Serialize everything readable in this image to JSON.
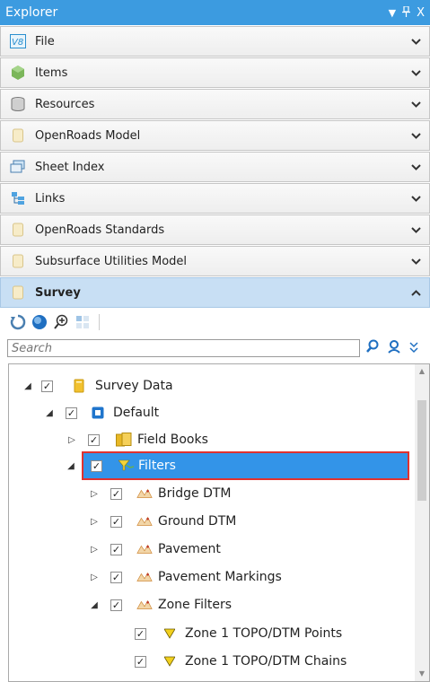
{
  "window": {
    "title": "Explorer",
    "controls": {
      "dropdown": "▼",
      "pin": "📌",
      "close": "X"
    }
  },
  "panels": [
    {
      "label": "File",
      "icon": "v8-file-icon"
    },
    {
      "label": "Items",
      "icon": "items-icon"
    },
    {
      "label": "Resources",
      "icon": "resources-icon"
    },
    {
      "label": "OpenRoads Model",
      "icon": "openroads-model-icon"
    },
    {
      "label": "Sheet Index",
      "icon": "sheet-index-icon"
    },
    {
      "label": "Links",
      "icon": "links-icon"
    },
    {
      "label": "OpenRoads Standards",
      "icon": "openroads-standards-icon"
    },
    {
      "label": "Subsurface Utilities Model",
      "icon": "subsurface-icon"
    },
    {
      "label": "Survey",
      "icon": "survey-icon",
      "expanded": true
    }
  ],
  "search": {
    "placeholder": "Search"
  },
  "tree": [
    {
      "label": "Survey Data",
      "expander": "◢",
      "checked": "✓"
    },
    {
      "label": "Default",
      "expander": "◢",
      "checked": "✓"
    },
    {
      "label": "Field Books",
      "expander": "▷",
      "checked": "✓"
    },
    {
      "label": "Filters",
      "expander": "◢",
      "checked": "✓",
      "selected": true
    },
    {
      "label": "Bridge DTM",
      "expander": "▷",
      "checked": "✓"
    },
    {
      "label": "Ground DTM",
      "expander": "▷",
      "checked": "✓"
    },
    {
      "label": "Pavement",
      "expander": "▷",
      "checked": "✓"
    },
    {
      "label": "Pavement Markings",
      "expander": "▷",
      "checked": "✓"
    },
    {
      "label": "Zone Filters",
      "expander": "◢",
      "checked": "✓"
    },
    {
      "label": "Zone 1 TOPO/DTM Points",
      "expander": "",
      "checked": "✓"
    },
    {
      "label": "Zone 1 TOPO/DTM Chains",
      "expander": "",
      "checked": "✓"
    }
  ],
  "colors": {
    "title_bar": "#3c9be0",
    "active_panel": "#c8dff4",
    "selection": "#3394e8",
    "highlight_outline": "#e0322f"
  }
}
